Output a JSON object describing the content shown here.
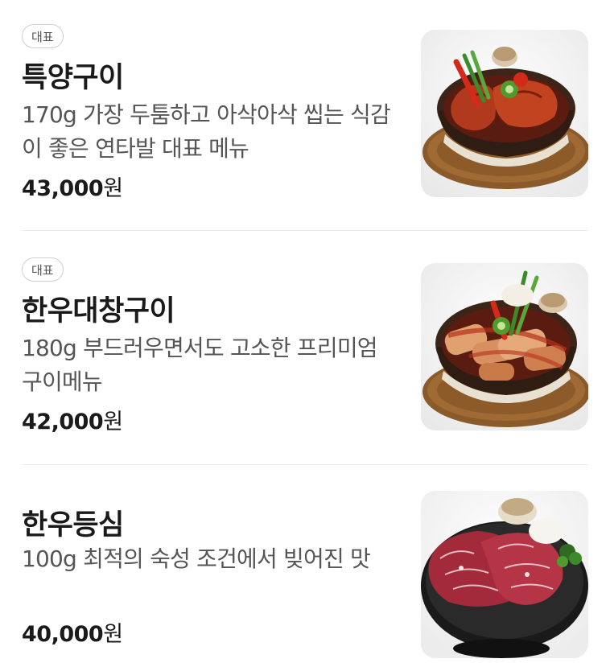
{
  "menu": {
    "items": [
      {
        "badge": "대표",
        "name": "특양구이",
        "description": "170g 가장 두툼하고 아삭아삭 씹는 식감이 좋은 연타발 대표 메뉴",
        "price": "43,000",
        "currency": "원",
        "image": "grilled-tripe-dish-icon"
      },
      {
        "badge": "대표",
        "name": "한우대창구이",
        "description": "180g 부드러우면서도 고소한 프리미엄 구이메뉴",
        "price": "42,000",
        "currency": "원",
        "image": "grilled-intestine-dish-icon"
      },
      {
        "name": "한우등심",
        "description": "100g 최적의 숙성 조건에서 빚어진 맛",
        "price": "40,000",
        "currency": "원",
        "image": "sirloin-steak-plate-icon"
      }
    ]
  },
  "colors": {
    "text_primary": "#1a1a1a",
    "text_secondary": "#555555",
    "badge_border": "#cfcfcf",
    "divider": "#ececec"
  }
}
